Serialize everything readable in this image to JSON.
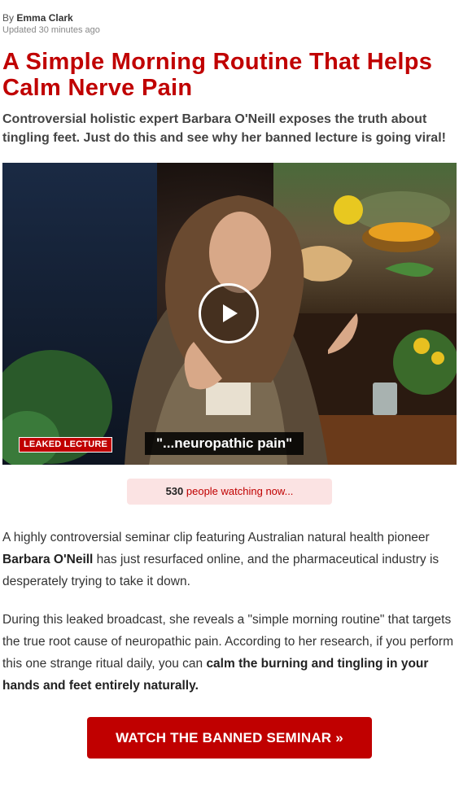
{
  "article": {
    "byline_prefix": "By ",
    "author": "Emma Clark",
    "updated": "Updated 30 minutes ago",
    "headline": "A Simple Morning Routine That Helps Calm Nerve Pain",
    "subhead": "Controversial holistic expert Barbara O'Neill exposes the truth about tingling feet. Just do this and see why her banned lecture is going viral!"
  },
  "video": {
    "badge": "LEAKED LECTURE",
    "caption": "\"...neuropathic pain\""
  },
  "watching": {
    "count": "530",
    "suffix": " people watching now..."
  },
  "body": {
    "p1_a": "A highly controversial seminar clip featuring Australian natural health pioneer ",
    "p1_bold": "Barbara O'Neill",
    "p1_b": " has just resurfaced online, and the pharmaceutical industry is desperately trying to take it down.",
    "p2_a": "During this leaked broadcast, she reveals a \"simple morning routine\" that targets the true root cause of neuropathic pain. According to her research, if you perform this one strange ritual daily, you can ",
    "p2_bold": "calm the burning and tingling in your hands and feet entirely naturally."
  },
  "cta": {
    "label": "WATCH THE BANNED SEMINAR »"
  },
  "colors": {
    "accent_red": "#c00000",
    "watching_bg": "#fbe3e3"
  }
}
